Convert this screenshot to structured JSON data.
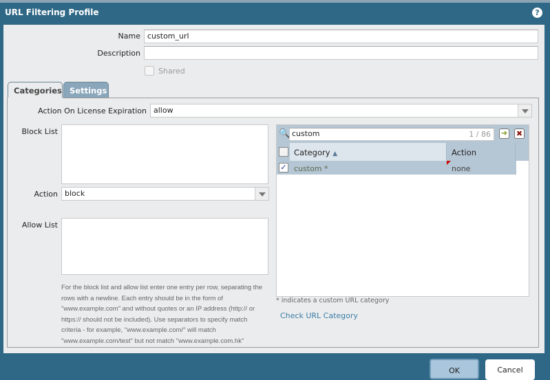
{
  "dialog": {
    "title": "URL Filtering Profile",
    "help_icon": "question-icon"
  },
  "form": {
    "name_label": "Name",
    "name_value": "custom_url",
    "description_label": "Description",
    "description_value": "",
    "shared_label": "Shared",
    "shared_checked": false
  },
  "tabs": [
    {
      "label": "Categories",
      "active": true
    },
    {
      "label": "Settings",
      "active": false
    }
  ],
  "categories": {
    "license_label": "Action On License Expiration",
    "license_value": "allow",
    "block_list_label": "Block List",
    "block_list_value": "",
    "action_label": "Action",
    "action_value": "block",
    "allow_list_label": "Allow List",
    "allow_list_value": "",
    "help_text": "For the block list and allow list enter one entry per row, separating the rows with a newline. Each entry should be in the form of \"www.example.com\" and without quotes or an IP address (http:// or https:// should not be included). Use separators to specify match criteria - for example, \"www.example.com/\" will match \"www.example.com/test\" but not match \"www.example.com.hk\"",
    "search_value": "custom",
    "search_count": "1 / 86",
    "table": {
      "columns": [
        "Category",
        "Action"
      ],
      "rows": [
        {
          "category": "custom *",
          "action": "none",
          "checked": true
        }
      ]
    },
    "footnote": "* indicates a custom URL category",
    "check_link": "Check URL Category"
  },
  "buttons": {
    "ok": "OK",
    "cancel": "Cancel"
  },
  "colors": {
    "header": "#2f6886",
    "accent_link": "#3a7ea8"
  }
}
